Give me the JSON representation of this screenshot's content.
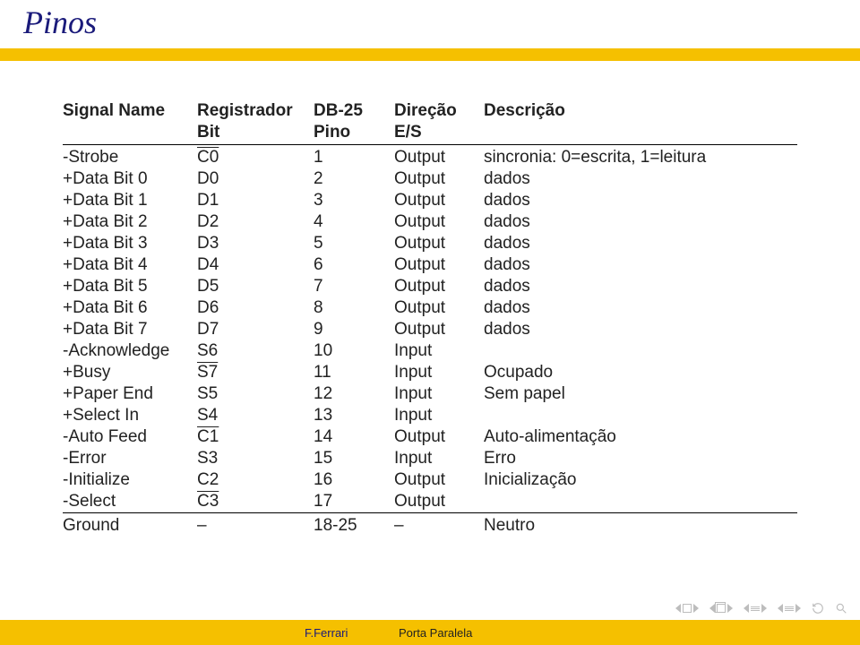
{
  "title": "Pinos",
  "table": {
    "headers": {
      "row1": {
        "sig": "Signal Name",
        "reg": "Registrador",
        "db25": "DB-25",
        "dir": "Direção",
        "desc": "Descrição"
      },
      "row2": {
        "sig": "",
        "reg": "Bit",
        "db25": "Pino",
        "dir": "E/S",
        "desc": ""
      }
    },
    "rows": [
      {
        "sig": "-Strobe",
        "reg": "C0",
        "overline": true,
        "db25": "1",
        "dir": "Output",
        "desc": "sincronia: 0=escrita, 1=leitura"
      },
      {
        "sig": "+Data Bit 0",
        "reg": "D0",
        "overline": false,
        "db25": "2",
        "dir": "Output",
        "desc": "dados"
      },
      {
        "sig": "+Data Bit 1",
        "reg": "D1",
        "overline": false,
        "db25": "3",
        "dir": "Output",
        "desc": "dados"
      },
      {
        "sig": "+Data Bit 2",
        "reg": "D2",
        "overline": false,
        "db25": "4",
        "dir": "Output",
        "desc": "dados"
      },
      {
        "sig": "+Data Bit 3",
        "reg": "D3",
        "overline": false,
        "db25": "5",
        "dir": "Output",
        "desc": "dados"
      },
      {
        "sig": "+Data Bit 4",
        "reg": "D4",
        "overline": false,
        "db25": "6",
        "dir": "Output",
        "desc": "dados"
      },
      {
        "sig": "+Data Bit 5",
        "reg": "D5",
        "overline": false,
        "db25": "7",
        "dir": "Output",
        "desc": "dados"
      },
      {
        "sig": "+Data Bit 6",
        "reg": "D6",
        "overline": false,
        "db25": "8",
        "dir": "Output",
        "desc": "dados"
      },
      {
        "sig": "+Data Bit 7",
        "reg": "D7",
        "overline": false,
        "db25": "9",
        "dir": "Output",
        "desc": "dados"
      },
      {
        "sig": "-Acknowledge",
        "reg": "S6",
        "overline": false,
        "db25": "10",
        "dir": "Input",
        "desc": ""
      },
      {
        "sig": "+Busy",
        "reg": "S7",
        "overline": true,
        "db25": "11",
        "dir": "Input",
        "desc": "Ocupado"
      },
      {
        "sig": "+Paper End",
        "reg": "S5",
        "overline": false,
        "db25": "12",
        "dir": "Input",
        "desc": "Sem papel"
      },
      {
        "sig": "+Select In",
        "reg": "S4",
        "overline": false,
        "db25": "13",
        "dir": "Input",
        "desc": ""
      },
      {
        "sig": "-Auto Feed",
        "reg": "C1",
        "overline": true,
        "db25": "14",
        "dir": "Output",
        "desc": "Auto-alimentação"
      },
      {
        "sig": "-Error",
        "reg": "S3",
        "overline": false,
        "db25": "15",
        "dir": "Input",
        "desc": "Erro"
      },
      {
        "sig": "-Initialize",
        "reg": "C2",
        "overline": false,
        "db25": "16",
        "dir": "Output",
        "desc": "Inicialização"
      },
      {
        "sig": "-Select",
        "reg": "C3",
        "overline": true,
        "db25": "17",
        "dir": "Output",
        "desc": ""
      },
      {
        "sig": "Ground",
        "reg": "–",
        "overline": false,
        "db25": "18-25",
        "dir": "–",
        "desc": "Neutro"
      }
    ]
  },
  "footer": {
    "author": "F.Ferrari",
    "topic": "Porta Paralela"
  }
}
